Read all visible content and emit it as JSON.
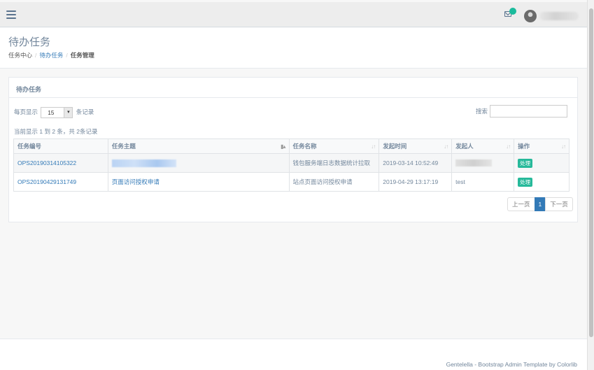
{
  "topnav": {
    "menu_icon": "hamburger-menu-icon",
    "mail_icon": "envelope-icon",
    "user_icon": "user-avatar"
  },
  "page": {
    "title": "待办任务",
    "breadcrumb": [
      "任务中心",
      "待办任务",
      "任务管理"
    ]
  },
  "panel": {
    "title": "待办任务",
    "length_prefix": "每页显示",
    "length_value": "15",
    "length_suffix": "条记录",
    "search_label": "搜索",
    "info": "当前显示 1 到 2 条，共 2条记录"
  },
  "table": {
    "headers": [
      "任务编号",
      "任务主题",
      "任务名称",
      "发起时间",
      "发起人",
      "操作"
    ],
    "rows": [
      {
        "id": "OPS20190314105322",
        "subject": "",
        "name": "钱包服务端日志数据统计拉取",
        "time": "2019-03-14 10:52:49",
        "initiator": "",
        "action": "处理"
      },
      {
        "id": "OPS20190429131749",
        "subject": "页面访问授权申请",
        "name": "站点页面访问授权申请",
        "time": "2019-04-29 13:17:19",
        "initiator": "test",
        "action": "处理"
      }
    ]
  },
  "pagination": {
    "prev": "上一页",
    "current": "1",
    "next": "下一页"
  },
  "footer": {
    "text": "Gentelella - Bootstrap Admin Template by Colorlib"
  },
  "colors": {
    "accent": "#337ab7",
    "success": "#26b99a",
    "badge": "#1abb9c"
  }
}
